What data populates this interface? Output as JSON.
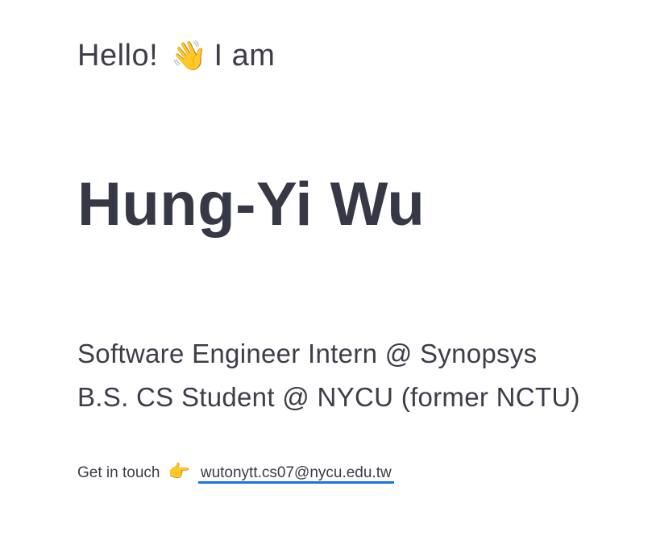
{
  "greeting": {
    "prefix": "Hello!",
    "emoji": "👋",
    "suffix": "I am"
  },
  "name": "Hung-Yi Wu",
  "roles": [
    "Software Engineer Intern @ Synopsys",
    "B.S. CS Student @ NYCU (former NCTU)"
  ],
  "contact": {
    "label": "Get in touch",
    "emoji": "👉",
    "email": "wutonytt.cs07@nycu.edu.tw",
    "link_underline_color": "#1a73e8"
  }
}
